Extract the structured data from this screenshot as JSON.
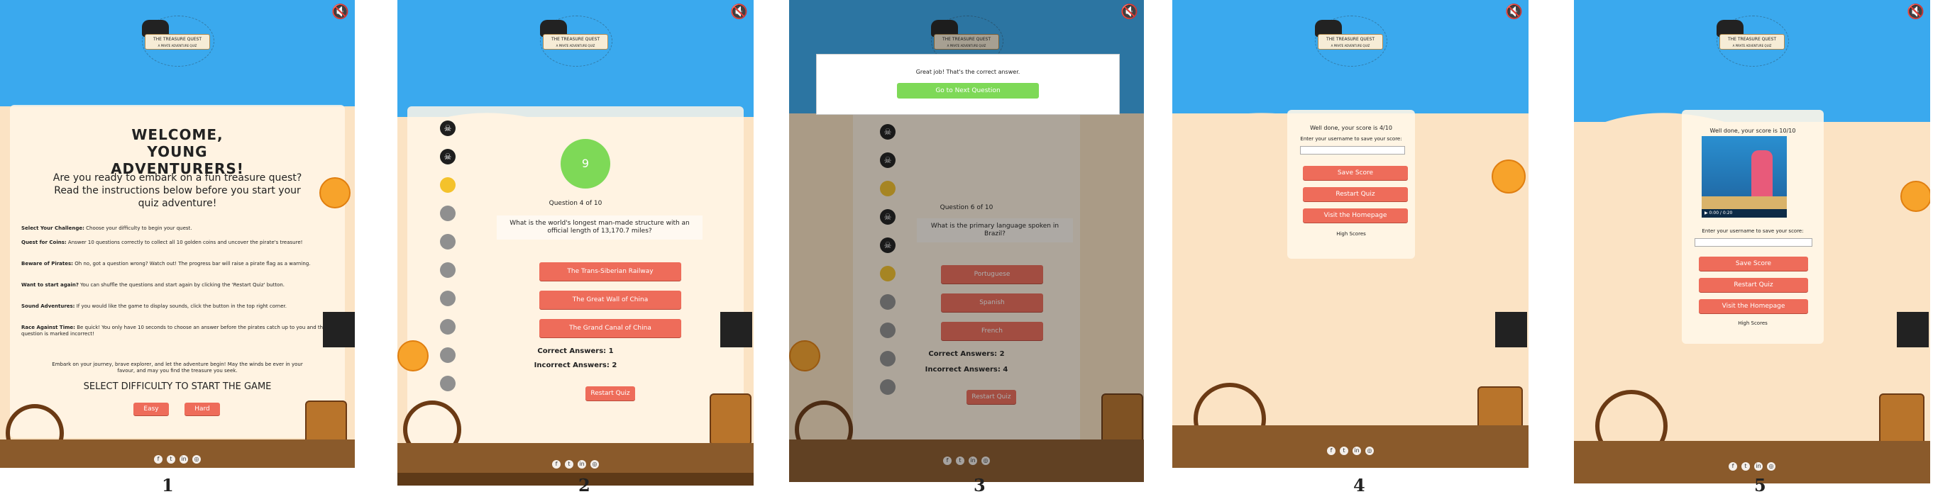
{
  "global": {
    "logo_title": "THE TREASURE QUEST",
    "logo_subtitle": "A PIRATE ADVENTURE QUIZ",
    "mute_icon": "mute-speaker-icon",
    "social_icons": [
      "facebook-icon",
      "twitter-icon",
      "linkedin-icon",
      "instagram-icon"
    ]
  },
  "captions": [
    "1",
    "2",
    "3",
    "4",
    "5"
  ],
  "screen1": {
    "heading": "WELCOME, YOUNG ADVENTURERS!",
    "intro": "Are you ready to embark on a fun treasure quest? Read the instructions below before you start your quiz adventure!",
    "instructions": [
      {
        "title": "Select Your Challenge:",
        "text": "Choose your difficulty to begin your quest."
      },
      {
        "title": "Quest for Coins:",
        "text": "Answer 10 questions correctly to collect all 10 golden coins and uncover the pirate's treasure!"
      },
      {
        "title": "Beware of Pirates:",
        "text": "Oh no, got a question wrong? Watch out! The progress bar will raise a pirate flag as a warning."
      },
      {
        "title": "Want to start again?",
        "text": "You can shuffle the questions and start again by clicking the 'Restart Quiz' button."
      },
      {
        "title": "Sound Adventures:",
        "text": "If you would like the game to display sounds, click the button in the top right corner."
      },
      {
        "title": "Race Against Time:",
        "text": "Be quick! You only have 10 seconds to choose an answer before the pirates catch up to you and the question is marked incorrect!"
      }
    ],
    "outro": "Embark on your journey, brave explorer, and let the adventure begin! May the winds be ever in your favour, and may you find the treasure you seek.",
    "select_difficulty": "SELECT DIFFICULTY TO START THE GAME",
    "easy_label": "Easy",
    "hard_label": "Hard"
  },
  "screen2": {
    "timer": "9",
    "question_counter": "Question 4 of 10",
    "question": "What is the world's longest man-made structure with an official length of 13,170.7 miles?",
    "answers": [
      "The Trans-Siberian Railway",
      "The Great Wall of China",
      "The Grand Canal of China"
    ],
    "correct_answers": "Correct Answers: 1",
    "incorrect_answers": "Incorrect Answers: 2",
    "restart_label": "Restart Quiz",
    "progress": [
      "skull",
      "skull",
      "coin",
      "empty",
      "empty",
      "empty",
      "empty",
      "empty",
      "empty",
      "empty"
    ]
  },
  "screen3": {
    "feedback_text": "Great job! That's the correct answer.",
    "next_label": "Go to Next Question",
    "question_counter": "Question 6 of 10",
    "question": "What is the primary language spoken in Brazil?",
    "answers": [
      "Portuguese",
      "Spanish",
      "French"
    ],
    "correct_answers": "Correct Answers: 2",
    "incorrect_answers": "Incorrect Answers: 4",
    "restart_label": "Restart Quiz",
    "progress": [
      "skull",
      "skull",
      "coin",
      "skull",
      "skull",
      "coin",
      "empty",
      "empty",
      "empty",
      "empty"
    ]
  },
  "screen4": {
    "score_text": "Well done, your score is 4/10",
    "username_prompt": "Enter your username to save your score:",
    "username_value": "",
    "save_label": "Save Score",
    "restart_label": "Restart Quiz",
    "home_label": "Visit the Homepage",
    "high_scores_label": "High Scores"
  },
  "screen5": {
    "score_text": "Well done, your score is 10/10",
    "video_time": "0:00 / 0:20",
    "username_prompt": "Enter your username to save your score:",
    "username_value": "",
    "save_label": "Save Score",
    "restart_label": "Restart Quiz",
    "home_label": "Visit the Homepage",
    "high_scores_label": "High Scores"
  },
  "colors": {
    "sky": "#3aa9ee",
    "sand": "#fbe3c4",
    "button": "#ee6c5a",
    "timer_green": "#7ed957",
    "next_green": "#7ed957"
  }
}
